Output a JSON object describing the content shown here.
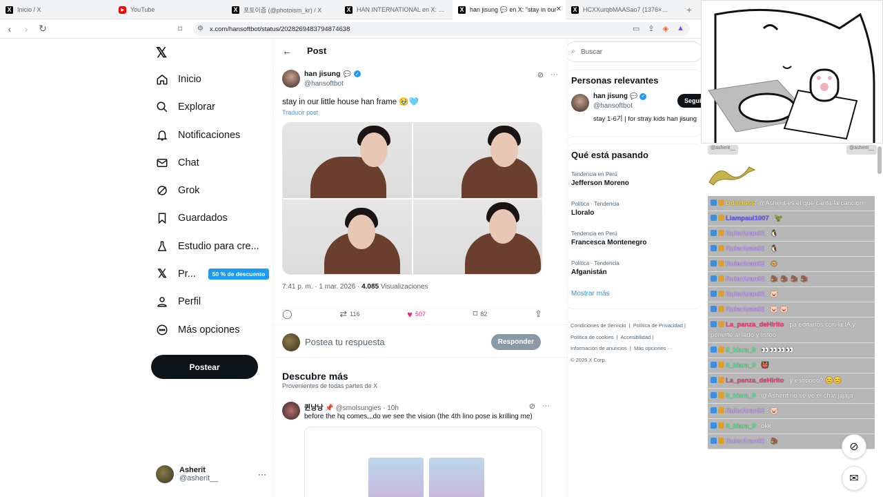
{
  "browser": {
    "tabs": [
      {
        "label": "Inicio / X",
        "icon": "x-logo-icon"
      },
      {
        "label": "YouTube",
        "icon": "youtube-icon"
      },
      {
        "label": "포토이즘 (@photoism_kr) / X",
        "icon": "x-logo-icon"
      },
      {
        "label": "HAN INTERNATIONAL en X: \"[💘📷",
        "icon": "x-logo-icon"
      },
      {
        "label": "han jisung 💬 en X: \"stay in our",
        "icon": "x-logo-icon",
        "active": true
      },
      {
        "label": "HCXXurqbMAASao7 (1376×4096)",
        "icon": "image-icon"
      }
    ],
    "url": "x.com/hansoftbot/status/2028269483794874638"
  },
  "sidebar": {
    "items": [
      {
        "label": "Inicio",
        "icon": "home-icon"
      },
      {
        "label": "Explorar",
        "icon": "search-icon"
      },
      {
        "label": "Notificaciones",
        "icon": "bell-icon"
      },
      {
        "label": "Chat",
        "icon": "mail-icon"
      },
      {
        "label": "Grok",
        "icon": "grok-icon"
      },
      {
        "label": "Guardados",
        "icon": "bookmark-icon"
      },
      {
        "label": "Estudio para cre...",
        "icon": "flask-icon"
      },
      {
        "label": "Pr...",
        "icon": "x-logo-icon",
        "promo": "50 % de descuento"
      },
      {
        "label": "Perfil",
        "icon": "person-icon"
      },
      {
        "label": "Más opciones",
        "icon": "more-circle-icon"
      }
    ],
    "post_label": "Postear",
    "user": {
      "name": "Asherit",
      "handle": "@asherit__"
    }
  },
  "post": {
    "header_title": "Post",
    "author_name": "han jisung",
    "author_handle": "@hansoftbot",
    "text": "stay in our little house han frame 🥹🩵",
    "translate": "Traducir post",
    "time": "7:41 p. m. · 1 mar. 2026 · ",
    "views_count": "4.085",
    "views_label": " Visualizaciones",
    "retweets": "116",
    "likes": "507",
    "bookmarks": "82",
    "reply_placeholder": "Postea tu respuesta",
    "reply_button": "Responder"
  },
  "discover": {
    "title": "Descubre más",
    "subtitle": "Provenientes de todas partes de X",
    "tweet": {
      "name": "퀸낭낭 📌",
      "handle_time": " @smolsungies · 10h",
      "text": "before the hq comes,,,do we see the vision (the 4th lino pose is krilling me)"
    }
  },
  "right": {
    "search_placeholder": "Buscar",
    "relevant_title": "Personas relevantes",
    "relevant": {
      "name": "han jisung",
      "handle": "@hansoftbot",
      "bio": "stay 1-6기 | for stray kids han jisung",
      "follow": "Seguir"
    },
    "trends_title": "Qué está pasando",
    "trends": [
      {
        "context": "Tendencia en Perú",
        "title": "Jefferson Moreno"
      },
      {
        "context": "Política · Tendencia",
        "title": "Lloralo"
      },
      {
        "context": "Tendencia en Perú",
        "title": "Francesca Montenegro"
      },
      {
        "context": "Política · Tendencia",
        "title": "Afganistán"
      }
    ],
    "show_more": "Mostrar más",
    "footer": [
      "Condiciones de Servicio",
      "Política de Privacidad",
      "Política de cookies",
      "Accesibilidad",
      "Información de anuncios",
      "Más opciones ···",
      "© 2026 X Corp."
    ]
  },
  "stream": {
    "overlay_left": "@asherit__",
    "overlay_right": "@asherit__",
    "messages": [
      {
        "user": "Ddaeloss",
        "text": ": @Asherit es el que canta la cancion",
        "color": "#f5d742"
      },
      {
        "user": "Liampaul1007",
        "text": " : 🦖",
        "color": "#6a5cff"
      },
      {
        "user": "RulerAran02",
        "text": " : 🐧",
        "color": "#c8a0ff"
      },
      {
        "user": "RulerAran02",
        "text": " : 🐧",
        "color": "#c8a0ff"
      },
      {
        "user": "RulerAran02",
        "text": " : 🐵",
        "color": "#c8a0ff"
      },
      {
        "user": "RulerAran02",
        "text": " : 🦣 🦣 🦣 🦣",
        "color": "#c8a0ff"
      },
      {
        "user": "RulerAran02",
        "text": " : 🐷",
        "color": "#c8a0ff"
      },
      {
        "user": "RulerAran02",
        "text": " : 🐷 🐷",
        "color": "#c8a0ff"
      },
      {
        "user": "La_panza_deHirito",
        "text": " : pa editarlos con la IA y ponerte al lado y listoo",
        "color": "#ff3b7a"
      },
      {
        "user": "0_kiara_0",
        "text": " : 👀👀👀👀",
        "color": "#3fff8a"
      },
      {
        "user": "0_kiara_0",
        "text": " : 👹",
        "color": "#3fff8a"
      },
      {
        "user": "La_panza_deHirito",
        "text": " : y esooooo? 😊😊",
        "color": "#ff3b7a"
      },
      {
        "user": "0_kiara_0",
        "text": " : @Asherit no se ve el chat jajaja",
        "color": "#3fff8a"
      },
      {
        "user": "RulerAran02",
        "text": " : 🐷",
        "color": "#c8a0ff"
      },
      {
        "user": "0_kiara_0",
        "text": " : okk",
        "color": "#3fff8a"
      },
      {
        "user": "RulerAran02",
        "text": " : 🦣",
        "color": "#c8a0ff"
      }
    ]
  },
  "colors": {
    "accent": "#1d9bf0",
    "like": "#f91880",
    "dark": "#0f1419"
  }
}
